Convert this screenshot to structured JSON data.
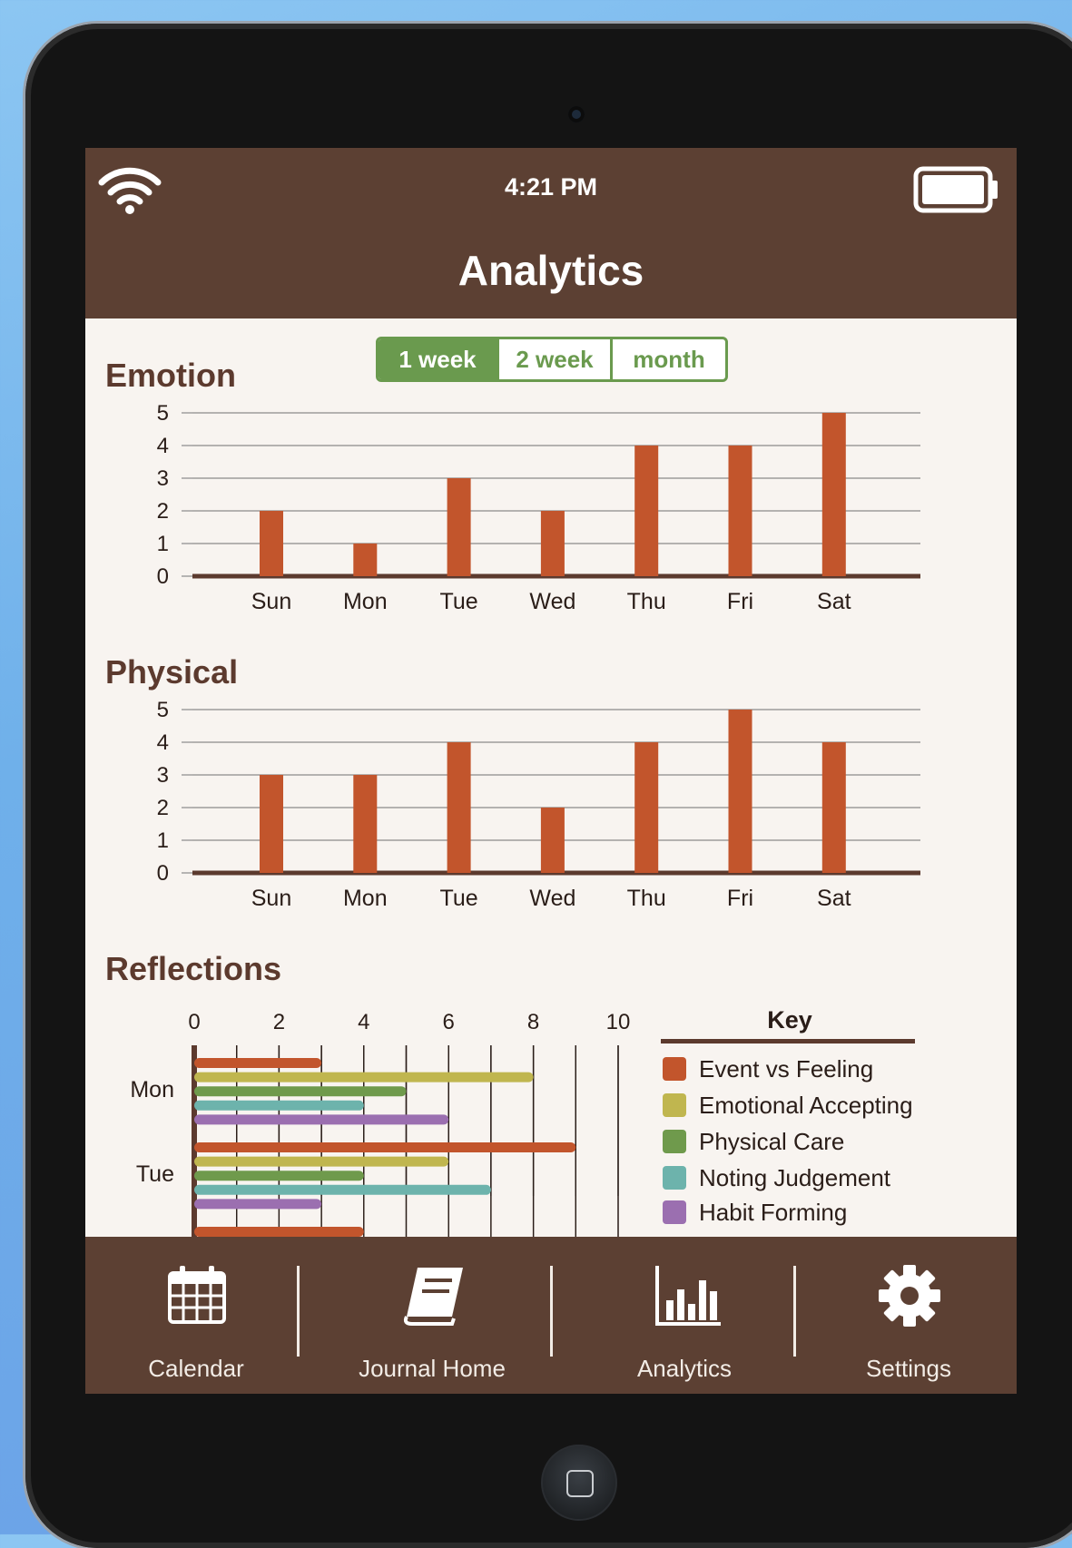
{
  "status": {
    "time": "4:21 PM"
  },
  "header": {
    "title": "Analytics"
  },
  "range_tabs": {
    "selected": "1 week",
    "options": [
      "1 week",
      "2 week",
      "month"
    ]
  },
  "sections": {
    "emotion": "Emotion",
    "physical": "Physical",
    "reflections": "Reflections"
  },
  "colors": {
    "bar": "#c2552c",
    "header_bg": "#5c4033",
    "accent_green": "#6a9a4e",
    "series": [
      "#c2552c",
      "#c0b64f",
      "#6f9a4c",
      "#6db3ac",
      "#9b6fb0"
    ]
  },
  "chart_data": [
    {
      "type": "bar",
      "title": "Emotion",
      "categories": [
        "Sun",
        "Mon",
        "Tue",
        "Wed",
        "Thu",
        "Fri",
        "Sat"
      ],
      "values": [
        2,
        1,
        3,
        2,
        4,
        4,
        5
      ],
      "ylim": [
        0,
        5
      ],
      "yticks": [
        0,
        1,
        2,
        3,
        4,
        5
      ],
      "grid": true
    },
    {
      "type": "bar",
      "title": "Physical",
      "categories": [
        "Sun",
        "Mon",
        "Tue",
        "Wed",
        "Thu",
        "Fri",
        "Sat"
      ],
      "values": [
        3,
        3,
        4,
        2,
        4,
        5,
        4
      ],
      "ylim": [
        0,
        5
      ],
      "yticks": [
        0,
        1,
        2,
        3,
        4,
        5
      ],
      "grid": true
    },
    {
      "type": "bar",
      "orientation": "horizontal",
      "title": "Reflections",
      "categories": [
        "Mon",
        "Tue"
      ],
      "xlim": [
        0,
        10
      ],
      "xticks": [
        0,
        2,
        4,
        6,
        8,
        10
      ],
      "series": [
        {
          "name": "Event vs Feeling",
          "values": [
            3,
            9
          ]
        },
        {
          "name": "Emotional Accepting",
          "values": [
            8,
            6
          ]
        },
        {
          "name": "Physical Care",
          "values": [
            5,
            4
          ]
        },
        {
          "name": "Noting Judgement",
          "values": [
            4,
            7
          ]
        },
        {
          "name": "Habit Forming",
          "values": [
            6,
            3
          ]
        }
      ],
      "legend": {
        "title": "Key",
        "position": "right"
      },
      "grid": true
    }
  ],
  "tabbar": {
    "items": [
      {
        "label": "Calendar",
        "icon": "calendar-icon"
      },
      {
        "label": "Journal Home",
        "icon": "book-icon"
      },
      {
        "label": "Analytics",
        "icon": "bar-chart-icon"
      },
      {
        "label": "Settings",
        "icon": "gear-icon"
      }
    ]
  }
}
